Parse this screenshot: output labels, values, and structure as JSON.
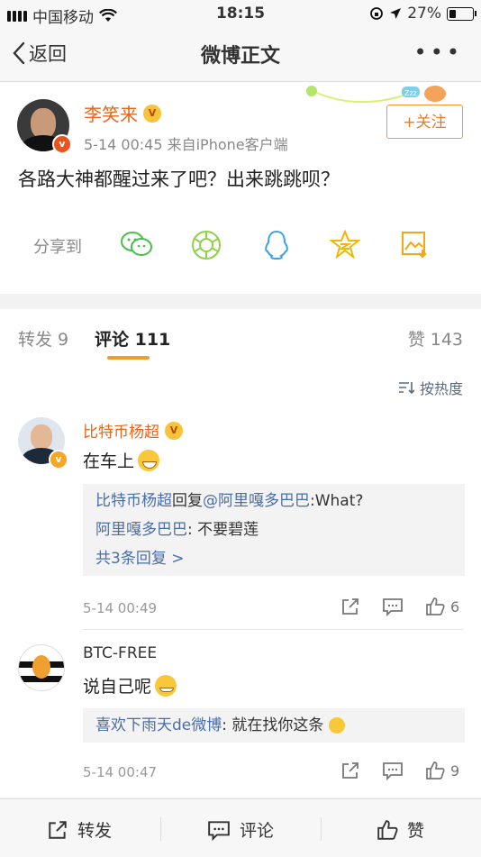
{
  "status_bar": {
    "carrier": "中国移动",
    "time": "18:15",
    "battery": "27%",
    "battery_level": 0.27
  },
  "nav": {
    "back_label": "返回",
    "title": "微博正文",
    "more": "•••"
  },
  "post": {
    "author": "李笑来",
    "time_source": "5-14 00:45  来自iPhone客户端",
    "follow_label": "+关注",
    "content": "各路大神都醒过来了吧？出来跳跳呗？",
    "share_label": "分享到",
    "share_targets": [
      "wechat-icon",
      "moments-icon",
      "qq-icon",
      "qzone-icon",
      "save-image-icon"
    ]
  },
  "tabs": [
    {
      "label": "转发 9"
    },
    {
      "label": "评论 111"
    },
    {
      "label": "赞 143"
    }
  ],
  "sort_label": "按热度",
  "comments": [
    {
      "name": "比特币杨超",
      "text": "在车上",
      "replies": [
        {
          "user": "比特币杨超",
          "mid": "回复",
          "target": "@阿里嘎多巴巴",
          "text": ":What?"
        },
        {
          "user": "阿里嘎多巴巴",
          "text": ": 不要碧莲"
        }
      ],
      "more_replies": "共3条回复 >",
      "time": "5-14 00:49",
      "likes": "6"
    },
    {
      "name": "BTC-FREE",
      "text": "说自己呢",
      "replies": [
        {
          "user": "喜欢下雨天de微博",
          "text": ": 就在找你这条"
        }
      ],
      "time": "5-14 00:47",
      "likes": "9"
    }
  ],
  "bottom_bar": {
    "repost": "转发",
    "comment": "评论",
    "like": "赞"
  },
  "colors": {
    "accent_orange": "#f29c2b",
    "name_orange": "#e5661c",
    "link_blue": "#4a6ea8"
  }
}
